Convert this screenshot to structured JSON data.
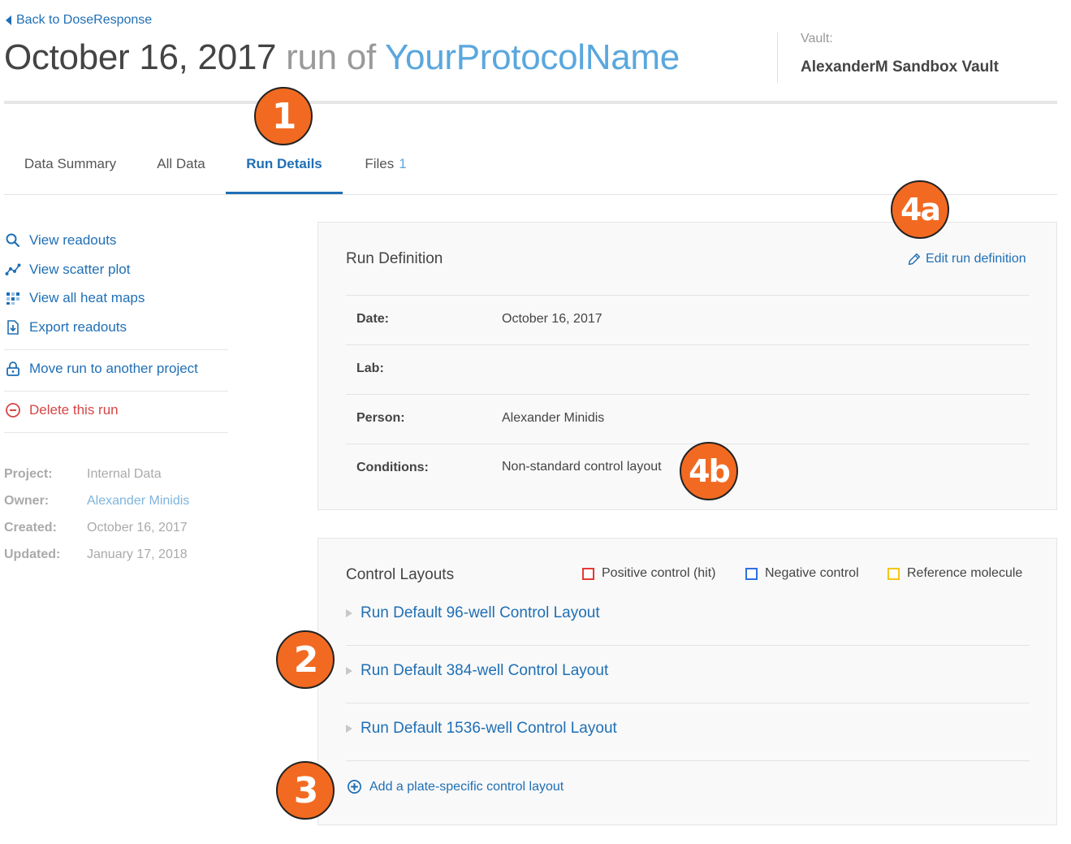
{
  "header": {
    "back_label": "Back to DoseResponse",
    "title_date": "October 16, 2017",
    "title_mid": "run of",
    "title_protocol": "YourProtocolName",
    "vault_label": "Vault:",
    "vault_name": "AlexanderM Sandbox Vault"
  },
  "tabs": [
    {
      "label": "Data Summary",
      "active": false
    },
    {
      "label": "All Data",
      "active": false
    },
    {
      "label": "Run Details",
      "active": true
    },
    {
      "label": "Files",
      "count": "1",
      "active": false
    }
  ],
  "sidebar": {
    "actions": [
      {
        "label": "View readouts",
        "icon": "search-icon"
      },
      {
        "label": "View scatter plot",
        "icon": "scatter-plot-icon"
      },
      {
        "label": "View all heat maps",
        "icon": "heat-map-icon"
      },
      {
        "label": "Export readouts",
        "icon": "export-icon"
      }
    ],
    "move_label": "Move run to another project",
    "delete_label": "Delete this run",
    "meta": [
      {
        "label": "Project:",
        "value": "Internal Data"
      },
      {
        "label": "Owner:",
        "value": "Alexander Minidis"
      },
      {
        "label": "Created:",
        "value": "October 16, 2017"
      },
      {
        "label": "Updated:",
        "value": "January 17, 2018"
      }
    ]
  },
  "run_definition": {
    "title": "Run Definition",
    "edit_label": "Edit run definition",
    "rows": [
      {
        "label": "Date:",
        "value": "October 16, 2017"
      },
      {
        "label": "Lab:",
        "value": ""
      },
      {
        "label": "Person:",
        "value": "Alexander Minidis"
      },
      {
        "label": "Conditions:",
        "value": "Non-standard control layout"
      }
    ]
  },
  "control_layouts": {
    "title": "Control Layouts",
    "legend": [
      {
        "label": "Positive control (hit)",
        "color": "#e53935"
      },
      {
        "label": "Negative control",
        "color": "#2f6fe0"
      },
      {
        "label": "Reference molecule",
        "color": "#f5c518"
      }
    ],
    "layouts": [
      "Run Default 96-well Control Layout",
      "Run Default 384-well Control Layout",
      "Run Default 1536-well Control Layout"
    ],
    "add_label": "Add a plate-specific control layout"
  },
  "callouts": {
    "one": "1",
    "two": "2",
    "three": "3",
    "four_a": "4a",
    "four_b": "4b"
  },
  "colors": {
    "link": "#1f6fb5",
    "protocol": "#5aa7dd",
    "danger": "#d64545",
    "callout": "#f26a21"
  }
}
